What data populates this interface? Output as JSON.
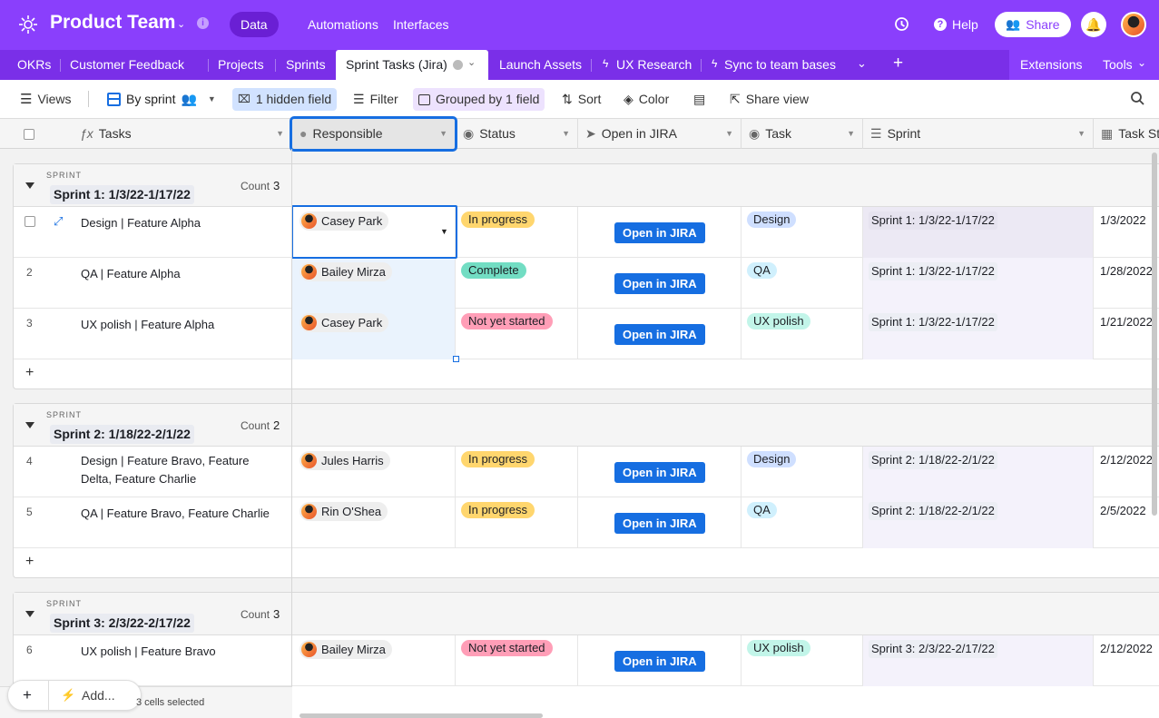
{
  "header": {
    "base_name": "Product Team",
    "nav": [
      "Data",
      "Automations",
      "Interfaces"
    ],
    "help_label": "Help",
    "share_label": "Share"
  },
  "tabs": [
    "OKRs",
    "Customer Feedback",
    "Projects",
    "Sprints",
    "Sprint Tasks (Jira)",
    "Launch Assets",
    "UX Research",
    "Sync to team bases"
  ],
  "tab_right": [
    "Extensions",
    "Tools"
  ],
  "toolbar": {
    "views": "Views",
    "view_name": "By sprint",
    "hidden": "1 hidden field",
    "filter": "Filter",
    "grouped": "Grouped by 1 field",
    "sort": "Sort",
    "color": "Color",
    "share_view": "Share view"
  },
  "columns": [
    "Tasks",
    "Responsible",
    "Status",
    "Open in JIRA",
    "Task",
    "Sprint",
    "Task Sta"
  ],
  "group_key": "SPRINT",
  "count_label": "Count",
  "jira_label": "Open in JIRA",
  "groups": [
    {
      "name": "Sprint 1: 1/3/22-1/17/22",
      "count": "3",
      "rows": [
        {
          "num": "",
          "task": "Design | Feature Alpha",
          "person": "Casey Park",
          "status": "In progress",
          "tasktype": "Design",
          "sprint": "Sprint 1: 1/3/22-1/17/22",
          "date": "1/3/2022"
        },
        {
          "num": "2",
          "task": "QA | Feature Alpha",
          "person": "Bailey Mirza",
          "status": "Complete",
          "tasktype": "QA",
          "sprint": "Sprint 1: 1/3/22-1/17/22",
          "date": "1/28/2022"
        },
        {
          "num": "3",
          "task": "UX polish | Feature Alpha",
          "person": "Casey Park",
          "status": "Not yet started",
          "tasktype": "UX polish",
          "sprint": "Sprint 1: 1/3/22-1/17/22",
          "date": "1/21/2022"
        }
      ]
    },
    {
      "name": "Sprint 2: 1/18/22-2/1/22",
      "count": "2",
      "rows": [
        {
          "num": "4",
          "task": "Design | Feature Bravo, Feature Delta, Feature Charlie",
          "person": "Jules Harris",
          "status": "In progress",
          "tasktype": "Design",
          "sprint": "Sprint 2: 1/18/22-2/1/22",
          "date": "2/12/2022"
        },
        {
          "num": "5",
          "task": "QA | Feature Bravo, Feature Charlie",
          "person": "Rin O'Shea",
          "status": "In progress",
          "tasktype": "QA",
          "sprint": "Sprint 2: 1/18/22-2/1/22",
          "date": "2/5/2022"
        }
      ]
    },
    {
      "name": "Sprint 3: 2/3/22-2/17/22",
      "count": "3",
      "rows": [
        {
          "num": "6",
          "task": "UX polish | Feature Bravo",
          "person": "Bailey Mirza",
          "status": "Not yet started",
          "tasktype": "UX polish",
          "sprint": "Sprint 3: 2/3/22-2/17/22",
          "date": "2/12/2022"
        }
      ]
    }
  ],
  "footer": {
    "add_label": "Add...",
    "selection": "3 cells selected"
  },
  "colors": {
    "brand": "#8a3ffc",
    "tabbar": "#7a2fe8",
    "selection": "#166ee1",
    "status_in_progress": "#ffd66e",
    "status_complete": "#72ddc3",
    "status_not_started": "#ff9eb7",
    "task_design": "#cfdfff",
    "task_qa": "#d0f0fd",
    "task_ux": "#c2f5e9"
  }
}
